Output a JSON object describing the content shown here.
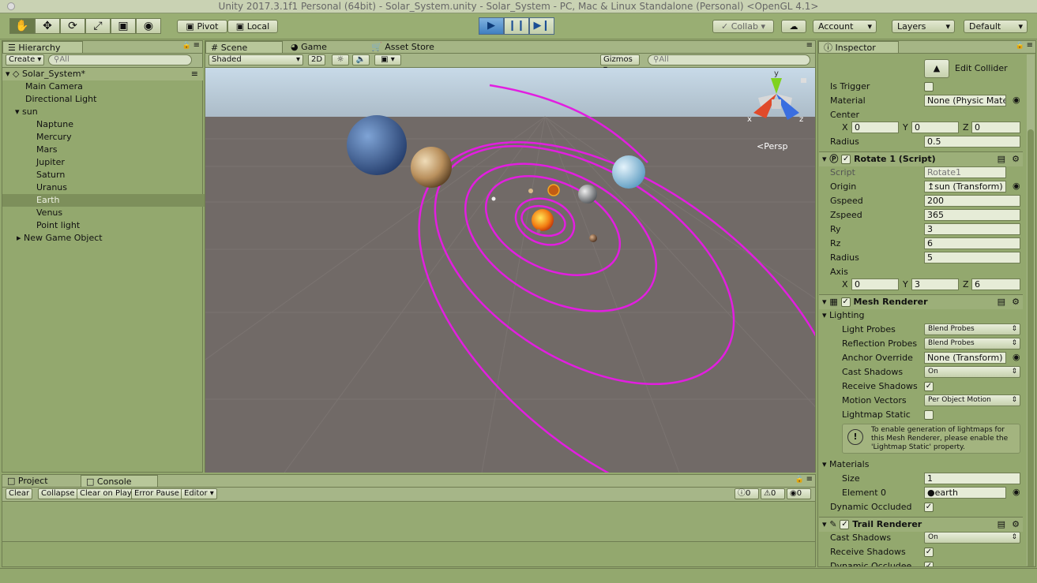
{
  "window": {
    "title": "Unity 2017.3.1f1 Personal (64bit) - Solar_System.unity - Solar_System - PC, Mac & Linux Standalone (Personal) <OpenGL 4.1>"
  },
  "toolbar": {
    "pivot": "Pivot",
    "local": "Local",
    "collab": "Collab",
    "account": "Account",
    "layers": "Layers",
    "layout": "Default"
  },
  "hierarchy": {
    "tab": "Hierarchy",
    "create": "Create",
    "search_placeholder": "All",
    "scene": "Solar_System*",
    "items": [
      {
        "label": "Main Camera"
      },
      {
        "label": "Directional Light"
      },
      {
        "label": "sun"
      },
      {
        "label": "Naptune"
      },
      {
        "label": "Mercury"
      },
      {
        "label": "Mars"
      },
      {
        "label": "Jupiter"
      },
      {
        "label": "Saturn"
      },
      {
        "label": "Uranus"
      },
      {
        "label": "Earth"
      },
      {
        "label": "Venus"
      },
      {
        "label": "Point light"
      },
      {
        "label": "New Game Object"
      }
    ]
  },
  "scene_view": {
    "tabs": [
      "Scene",
      "Game",
      "Asset Store"
    ],
    "shading": "Shaded",
    "mode_2d": "2D",
    "gizmos": "Gizmos",
    "search_placeholder": "All",
    "persp": "Persp",
    "orbit_color": "#e21ee0",
    "sky_color": "#c3d5e5",
    "ground_color": "#716a67",
    "axis_x": "x",
    "axis_y": "y",
    "axis_z": "z"
  },
  "console": {
    "tabs": [
      "Project",
      "Console"
    ],
    "buttons": [
      "Clear",
      "Collapse",
      "Clear on Play",
      "Error Pause",
      "Editor"
    ],
    "counts": [
      "0",
      "0",
      "0"
    ]
  },
  "inspector": {
    "tab": "Inspector",
    "sphere_collider": {
      "edit_collider": "Edit Collider",
      "is_trigger": "Is Trigger",
      "material": "Material",
      "material_value": "None (Physic Mater",
      "center": "Center",
      "center_x": "0",
      "center_y": "0",
      "center_z": "0",
      "radius": "Radius",
      "radius_value": "0.5"
    },
    "rotate": {
      "title": "Rotate 1 (Script)",
      "script": "Script",
      "script_value": "Rotate1",
      "origin": "Origin",
      "origin_value": "sun (Transform)",
      "gspeed": "Gspeed",
      "gspeed_value": "200",
      "zspeed": "Zspeed",
      "zspeed_value": "365",
      "ry": "Ry",
      "ry_value": "3",
      "rz": "Rz",
      "rz_value": "6",
      "radius": "Radius",
      "radius_value": "5",
      "axis": "Axis",
      "axis_x": "0",
      "axis_y": "3",
      "axis_z": "6"
    },
    "mesh_renderer": {
      "title": "Mesh Renderer",
      "lighting": "Lighting",
      "light_probes": "Light Probes",
      "light_probes_value": "Blend Probes",
      "reflection_probes": "Reflection Probes",
      "reflection_probes_value": "Blend Probes",
      "anchor_override": "Anchor Override",
      "anchor_override_value": "None (Transform)",
      "cast_shadows": "Cast Shadows",
      "cast_shadows_value": "On",
      "receive_shadows": "Receive Shadows",
      "motion_vectors": "Motion Vectors",
      "motion_vectors_value": "Per Object Motion",
      "lightmap_static": "Lightmap Static",
      "help_text": "To enable generation of lightmaps for this Mesh Renderer, please enable the 'Lightmap Static' property.",
      "materials": "Materials",
      "size": "Size",
      "size_value": "1",
      "element0": "Element 0",
      "element0_value": "earth",
      "dynamic_occluded": "Dynamic Occluded"
    },
    "trail_renderer": {
      "title": "Trail Renderer",
      "cast_shadows": "Cast Shadows",
      "cast_shadows_value": "On",
      "receive_shadows": "Receive Shadows",
      "dynamic_occludee": "Dynamic Occludee"
    }
  }
}
